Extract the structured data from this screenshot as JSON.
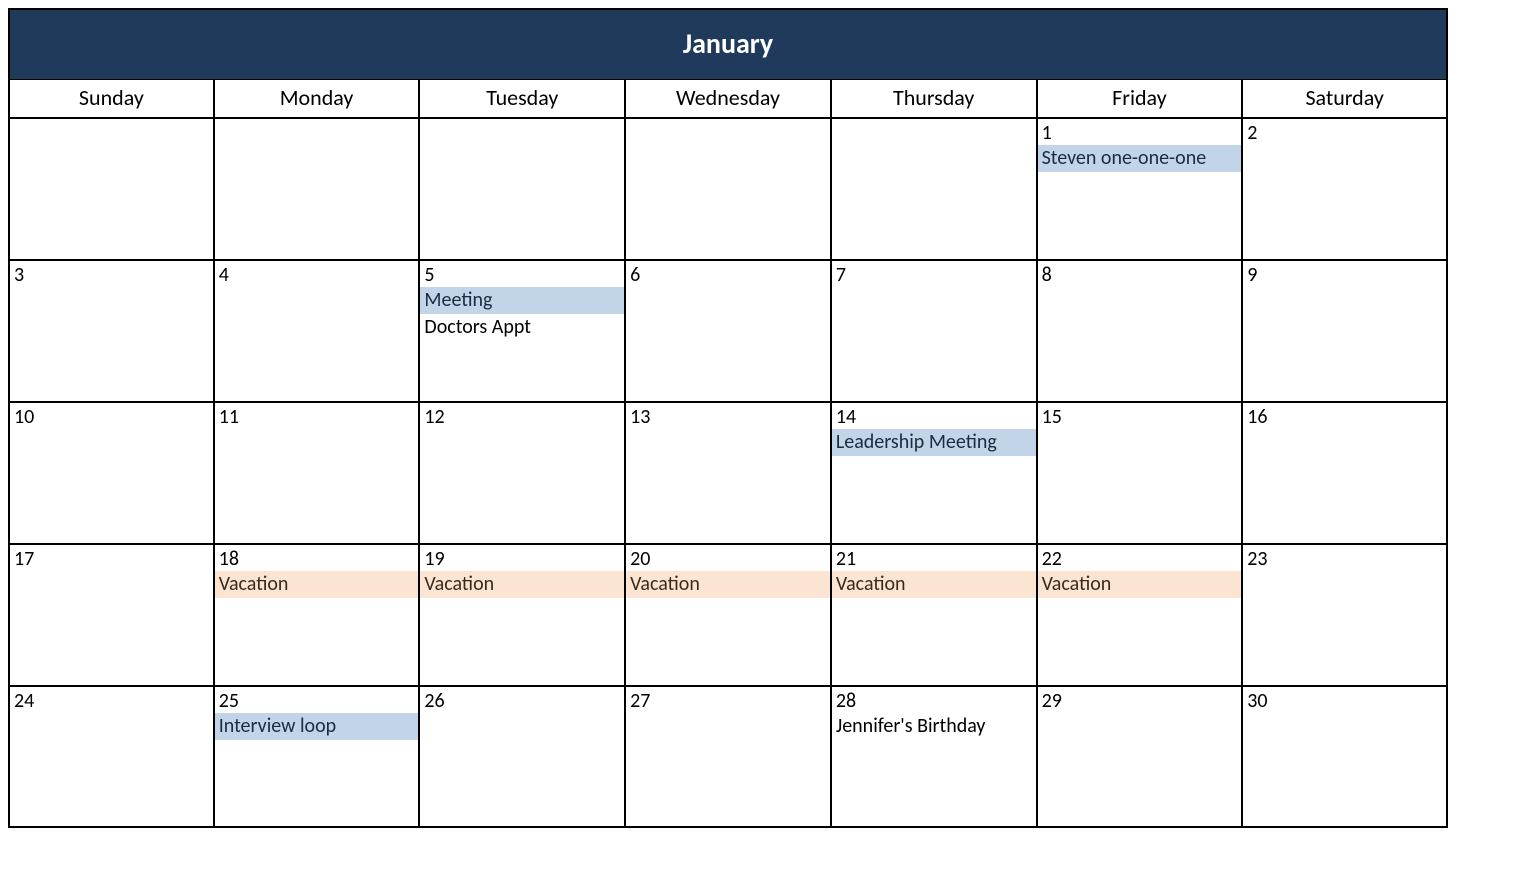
{
  "month_title": "January",
  "weekdays": [
    "Sunday",
    "Monday",
    "Tuesday",
    "Wednesday",
    "Thursday",
    "Friday",
    "Saturday"
  ],
  "weeks": [
    [
      {
        "day": "",
        "events": []
      },
      {
        "day": "",
        "events": []
      },
      {
        "day": "",
        "events": []
      },
      {
        "day": "",
        "events": []
      },
      {
        "day": "",
        "events": []
      },
      {
        "day": "1",
        "events": [
          {
            "label": "Steven one-one-one",
            "style": "blue"
          }
        ]
      },
      {
        "day": "2",
        "events": []
      }
    ],
    [
      {
        "day": "3",
        "events": []
      },
      {
        "day": "4",
        "events": []
      },
      {
        "day": "5",
        "events": [
          {
            "label": "Meeting",
            "style": "blue"
          },
          {
            "label": "Doctors Appt",
            "style": "plain"
          }
        ]
      },
      {
        "day": "6",
        "events": []
      },
      {
        "day": "7",
        "events": []
      },
      {
        "day": "8",
        "events": []
      },
      {
        "day": "9",
        "events": []
      }
    ],
    [
      {
        "day": "10",
        "events": []
      },
      {
        "day": "11",
        "events": []
      },
      {
        "day": "12",
        "events": []
      },
      {
        "day": "13",
        "events": []
      },
      {
        "day": "14",
        "events": [
          {
            "label": "Leadership Meeting",
            "style": "blue"
          }
        ]
      },
      {
        "day": "15",
        "events": []
      },
      {
        "day": "16",
        "events": []
      }
    ],
    [
      {
        "day": "17",
        "events": []
      },
      {
        "day": "18",
        "events": [
          {
            "label": "Vacation",
            "style": "peach"
          }
        ]
      },
      {
        "day": "19",
        "events": [
          {
            "label": "Vacation",
            "style": "peach"
          }
        ]
      },
      {
        "day": "20",
        "events": [
          {
            "label": "Vacation",
            "style": "peach"
          }
        ]
      },
      {
        "day": "21",
        "events": [
          {
            "label": "Vacation",
            "style": "peach"
          }
        ]
      },
      {
        "day": "22",
        "events": [
          {
            "label": "Vacation",
            "style": "peach"
          }
        ]
      },
      {
        "day": "23",
        "events": []
      }
    ],
    [
      {
        "day": "24",
        "events": []
      },
      {
        "day": "25",
        "events": [
          {
            "label": "Interview loop",
            "style": "blue"
          }
        ]
      },
      {
        "day": "26",
        "events": []
      },
      {
        "day": "27",
        "events": []
      },
      {
        "day": "28",
        "events": [
          {
            "label": "Jennifer's Birthday",
            "style": "plain"
          }
        ]
      },
      {
        "day": "29",
        "events": []
      },
      {
        "day": "30",
        "events": []
      }
    ]
  ]
}
